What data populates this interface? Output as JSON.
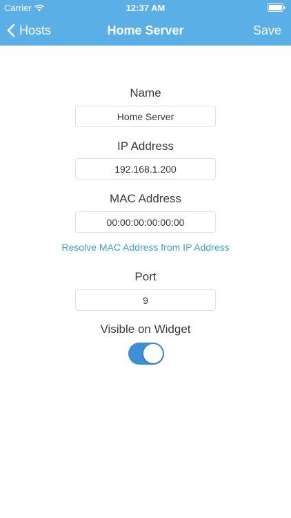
{
  "status_bar": {
    "carrier": "Carrier",
    "time": "12:37 AM"
  },
  "nav": {
    "back_label": "Hosts",
    "title": "Home Server",
    "save_label": "Save"
  },
  "form": {
    "name": {
      "label": "Name",
      "value": "Home Server"
    },
    "ip": {
      "label": "IP Address",
      "value": "192.168.1.200"
    },
    "mac": {
      "label": "MAC Address",
      "value": "00:00:00:00:00:00"
    },
    "resolve_link": "Resolve MAC Address from IP Address",
    "port": {
      "label": "Port",
      "value": "9"
    },
    "widget": {
      "label": "Visible on Widget",
      "enabled": true
    }
  },
  "colors": {
    "nav_bar": "#5aafe6",
    "toggle_on": "#3d8fd6",
    "link": "#3c9fd9"
  }
}
